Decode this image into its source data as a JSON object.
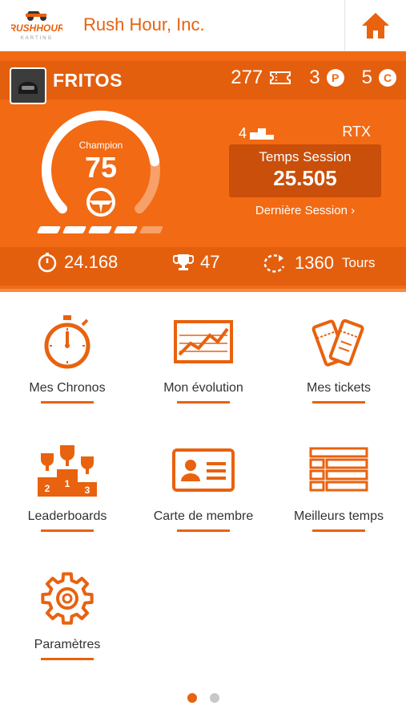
{
  "header": {
    "logo_text": "RUSHHOUR",
    "logo_sub": "KARTING",
    "title": "Rush Hour, Inc.",
    "home_icon": "home-icon"
  },
  "profile": {
    "username": "FRITOS",
    "tickets": "277",
    "points": "3",
    "points_badge": "P",
    "credits": "5",
    "credits_badge": "C",
    "level_label": "Champion",
    "level_value": "75",
    "level_progress": 0.8,
    "progress_segments_filled": 4,
    "progress_segments_total": 5,
    "rank": "4",
    "kart_class": "RTX",
    "session_label": "Temps Session",
    "session_value": "25.505",
    "last_session_link": "Dernière Session",
    "best_time": "24.168",
    "trophies": "47",
    "laps": "1360",
    "laps_unit": "Tours"
  },
  "menu": [
    {
      "label": "Mes Chronos",
      "icon": "stopwatch-icon"
    },
    {
      "label": "Mon évolution",
      "icon": "chart-icon"
    },
    {
      "label": "Mes tickets",
      "icon": "tickets-icon"
    },
    {
      "label": "Leaderboards",
      "icon": "podium-icon"
    },
    {
      "label": "Carte de membre",
      "icon": "member-card-icon"
    },
    {
      "label": "Meilleurs temps",
      "icon": "list-icon"
    },
    {
      "label": "Paramètres",
      "icon": "gear-icon"
    }
  ],
  "pagination": {
    "current": 1,
    "total": 2
  },
  "colors": {
    "accent": "#e8620f",
    "panel": "#f26a14"
  }
}
